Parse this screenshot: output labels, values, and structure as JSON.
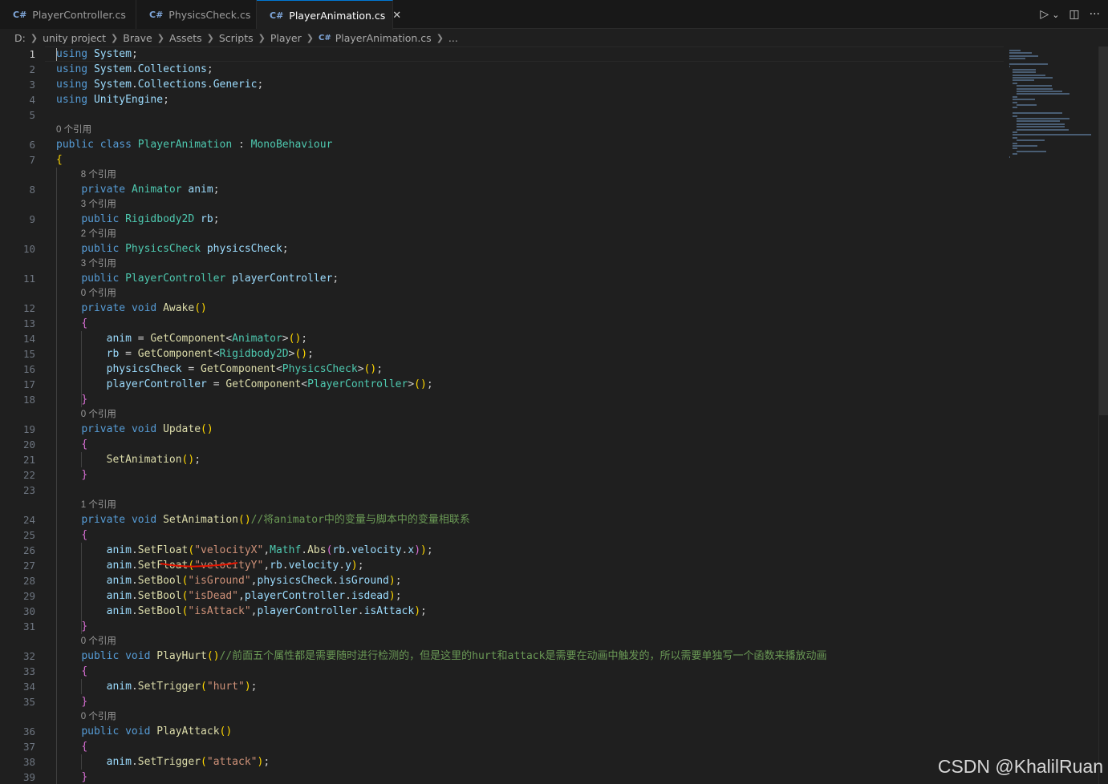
{
  "tabs": [
    {
      "label": "PlayerController.cs",
      "icon": "csharp-file-icon"
    },
    {
      "label": "PhysicsCheck.cs",
      "icon": "csharp-file-icon"
    },
    {
      "label": "PlayerAnimation.cs",
      "icon": "csharp-file-icon",
      "active": true
    }
  ],
  "tab_actions": {
    "run": "▷",
    "run_menu": "⌄",
    "split": "◫",
    "more": "···",
    "close": "✕"
  },
  "breadcrumb": [
    "D:",
    "unity project",
    "Brave",
    "Assets",
    "Scripts",
    "Player",
    "PlayerAnimation.cs",
    "..."
  ],
  "code": {
    "lines": [
      "using System;",
      "using System.Collections;",
      "using System.Collections.Generic;",
      "using UnityEngine;",
      "",
      "public class PlayerAnimation : MonoBehaviour",
      "{",
      "    private Animator anim;",
      "    public Rigidbody2D rb;",
      "    public PhysicsCheck physicsCheck;",
      "    public PlayerController playerController;",
      "    private void Awake()",
      "    {",
      "        anim = GetComponent<Animator>();",
      "        rb = GetComponent<Rigidbody2D>();",
      "        physicsCheck = GetComponent<PhysicsCheck>();",
      "        playerController = GetComponent<PlayerController>();",
      "    }",
      "    private void Update()",
      "    {",
      "        SetAnimation();",
      "    }",
      "",
      "    private void SetAnimation()//将animator中的变量与脚本中的变量相联系",
      "    {",
      "        anim.SetFloat(\"velocityX\",Mathf.Abs(rb.velocity.x));",
      "        anim.SetFloat(\"velocityY\",rb.velocity.y);",
      "        anim.SetBool(\"isGround\",physicsCheck.isGround);",
      "        anim.SetBool(\"isDead\",playerController.isdead);",
      "        anim.SetBool(\"isAttack\",playerController.isAttack);",
      "    }",
      "    public void PlayHurt()//前面五个属性都是需要随时进行检测的，但是这里的hurt和attack是需要在动画中触发的，所以需要单独写一个函数来播放动画",
      "    {",
      "        anim.SetTrigger(\"hurt\");",
      "    }",
      "    public void PlayAttack()",
      "    {",
      "        anim.SetTrigger(\"attack\");",
      "    }",
      "}"
    ],
    "codelens": [
      {
        "before_line": 6,
        "text": "0 个引用"
      },
      {
        "before_line": 8,
        "text": "8 个引用"
      },
      {
        "before_line": 9,
        "text": "3 个引用"
      },
      {
        "before_line": 10,
        "text": "2 个引用"
      },
      {
        "before_line": 11,
        "text": "3 个引用"
      },
      {
        "before_line": 12,
        "text": "0 个引用"
      },
      {
        "before_line": 19,
        "text": "0 个引用"
      },
      {
        "before_line": 24,
        "text": "1 个引用"
      },
      {
        "before_line": 32,
        "text": "0 个引用"
      },
      {
        "before_line": 36,
        "text": "0 个引用"
      }
    ],
    "active_line": 1,
    "highlighted_identifier": "SetAnimation"
  },
  "colors": {
    "keyword": "#569cd6",
    "type": "#4ec9b0",
    "function": "#dcdcaa",
    "variable": "#9cdcfe",
    "string": "#ce9178",
    "comment": "#6a9955",
    "underline_annotation": "#e51400"
  },
  "watermark": "CSDN @KhalilRuan"
}
